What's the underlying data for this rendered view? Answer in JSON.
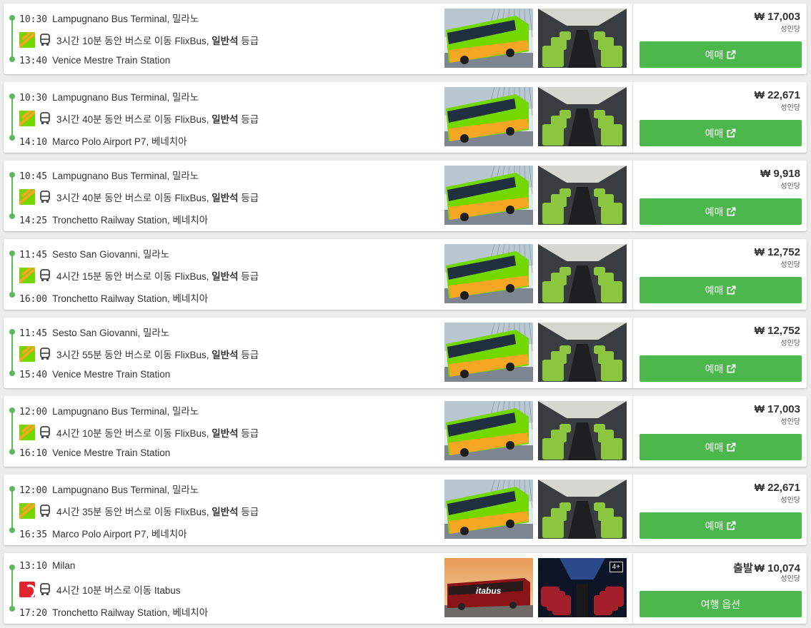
{
  "colors": {
    "accent": "#4cb74c",
    "timeline": "#5cb85c",
    "flixbus": "#73d700",
    "itabus": "#e0262d"
  },
  "results": [
    {
      "dep_time": "10:30",
      "dep_place": "Lampugnano Bus Terminal, 밀라노",
      "operator": "flixbus",
      "duration": "3시간 10분 동안 버스로 이동 FlixBus,",
      "class_label": "일반석",
      "class_suffix": "등급",
      "arr_time": "13:40",
      "arr_place": "Venice Mestre Train Station",
      "price_prefix": "",
      "price": "₩ 17,003",
      "per": "성인당",
      "button": "예매",
      "button_icon": "external-link-icon"
    },
    {
      "dep_time": "10:30",
      "dep_place": "Lampugnano Bus Terminal, 밀라노",
      "operator": "flixbus",
      "duration": "3시간 40분 동안 버스로 이동 FlixBus,",
      "class_label": "일반석",
      "class_suffix": "등급",
      "arr_time": "14:10",
      "arr_place": "Marco Polo Airport P7, 베네치아",
      "price_prefix": "",
      "price": "₩ 22,671",
      "per": "성인당",
      "button": "예매",
      "button_icon": "external-link-icon"
    },
    {
      "dep_time": "10:45",
      "dep_place": "Lampugnano Bus Terminal, 밀라노",
      "operator": "flixbus",
      "duration": "3시간 40분 동안 버스로 이동 FlixBus,",
      "class_label": "일반석",
      "class_suffix": "등급",
      "arr_time": "14:25",
      "arr_place": "Tronchetto Railway Station, 베네치아",
      "price_prefix": "",
      "price": "₩ 9,918",
      "per": "성인당",
      "button": "예매",
      "button_icon": "external-link-icon"
    },
    {
      "dep_time": "11:45",
      "dep_place": "Sesto San Giovanni, 밀라노",
      "operator": "flixbus",
      "duration": "4시간 15분 동안 버스로 이동 FlixBus,",
      "class_label": "일반석",
      "class_suffix": "등급",
      "arr_time": "16:00",
      "arr_place": "Tronchetto Railway Station, 베네치아",
      "price_prefix": "",
      "price": "₩ 12,752",
      "per": "성인당",
      "button": "예매",
      "button_icon": "external-link-icon"
    },
    {
      "dep_time": "11:45",
      "dep_place": "Sesto San Giovanni, 밀라노",
      "operator": "flixbus",
      "duration": "3시간 55분 동안 버스로 이동 FlixBus,",
      "class_label": "일반석",
      "class_suffix": "등급",
      "arr_time": "15:40",
      "arr_place": "Venice Mestre Train Station",
      "price_prefix": "",
      "price": "₩ 12,752",
      "per": "성인당",
      "button": "예매",
      "button_icon": "external-link-icon"
    },
    {
      "dep_time": "12:00",
      "dep_place": "Lampugnano Bus Terminal, 밀라노",
      "operator": "flixbus",
      "duration": "4시간 10분 동안 버스로 이동 FlixBus,",
      "class_label": "일반석",
      "class_suffix": "등급",
      "arr_time": "16:10",
      "arr_place": "Venice Mestre Train Station",
      "price_prefix": "",
      "price": "₩ 17,003",
      "per": "성인당",
      "button": "예매",
      "button_icon": "external-link-icon"
    },
    {
      "dep_time": "12:00",
      "dep_place": "Lampugnano Bus Terminal, 밀라노",
      "operator": "flixbus",
      "duration": "4시간 35분 동안 버스로 이동 FlixBus,",
      "class_label": "일반석",
      "class_suffix": "등급",
      "arr_time": "16:35",
      "arr_place": "Marco Polo Airport P7, 베네치아",
      "price_prefix": "",
      "price": "₩ 22,671",
      "per": "성인당",
      "button": "예매",
      "button_icon": "external-link-icon"
    },
    {
      "dep_time": "13:10",
      "dep_place": "Milan",
      "operator": "itabus",
      "duration": "4시간 10분 버스로 이동 Itabus",
      "class_label": "",
      "class_suffix": "",
      "arr_time": "17:20",
      "arr_place": "Tronchetto Railway Station, 베네치아",
      "price_prefix": "출발",
      "price": "₩ 10,074",
      "per": "성인당",
      "button": "여행 옵션",
      "button_icon": "",
      "more_photos": "4+",
      "bus_livery_text": "itabus"
    }
  ]
}
